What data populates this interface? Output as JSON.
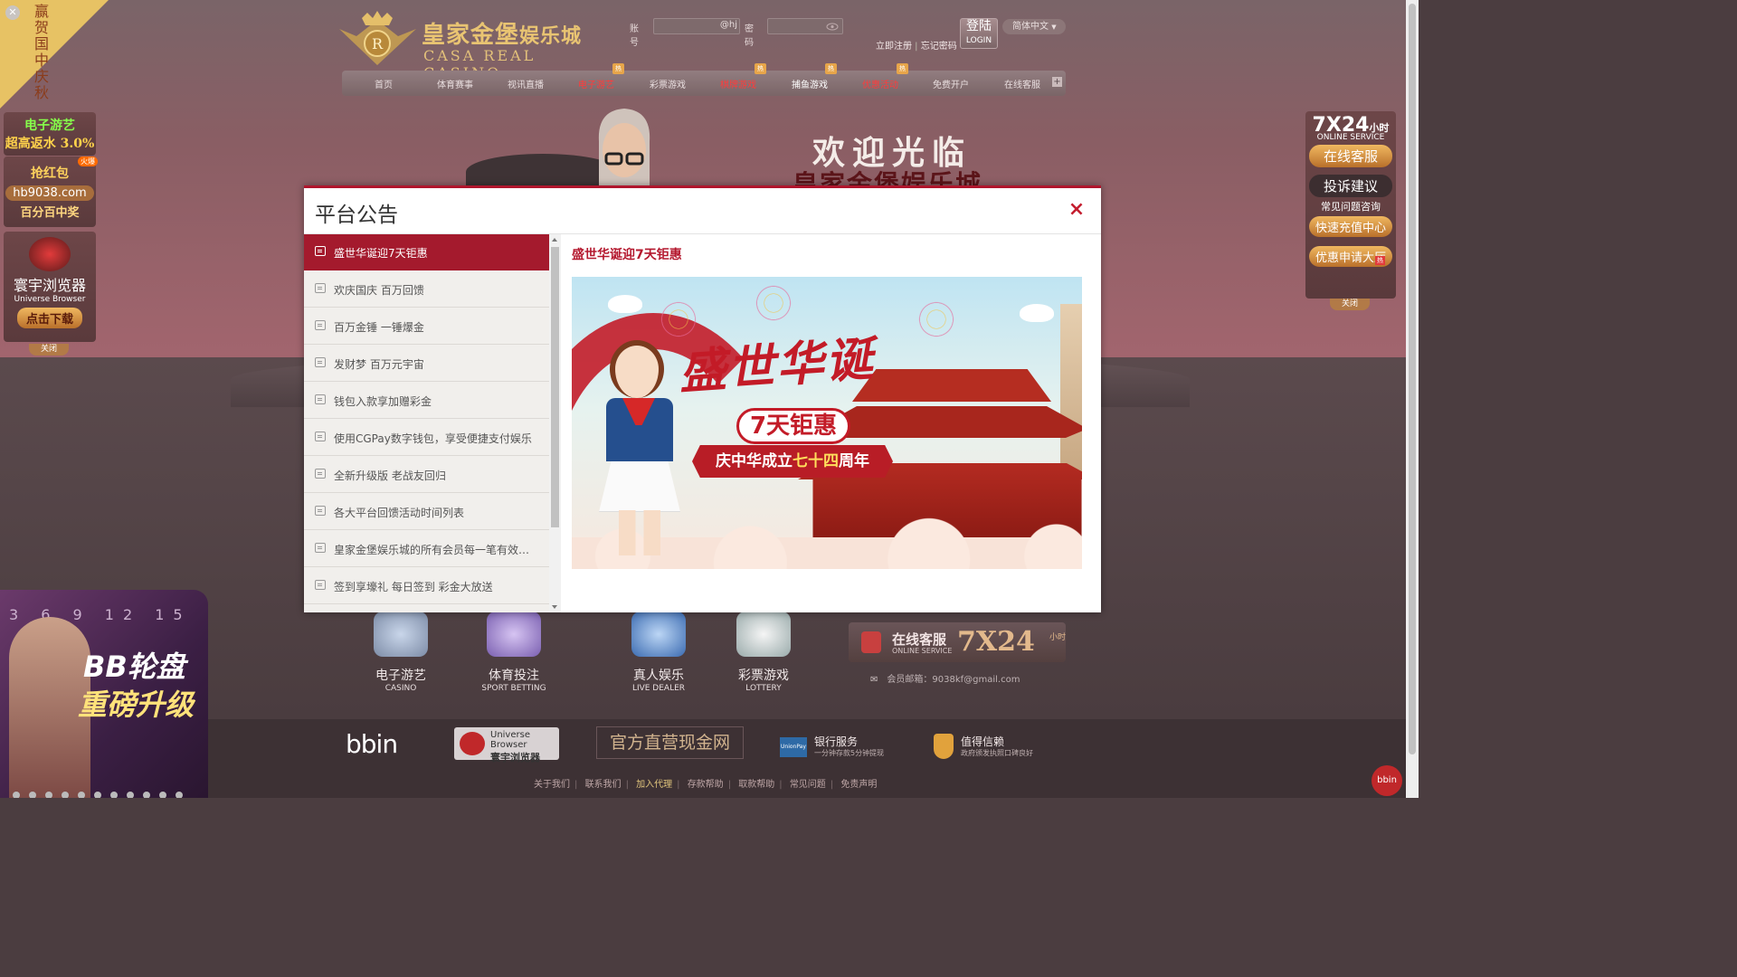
{
  "header": {
    "logo_cn_main": "皇家金堡",
    "logo_cn_small": "娱乐城",
    "logo_en": "CASA REAL CASINO",
    "account_label": "账号",
    "account_suffix": "@hj",
    "password_label": "密码",
    "login_label": "登陆",
    "login_sub": "LOGIN",
    "language": "简体中文",
    "register": "立即注册",
    "forgot": "忘记密码"
  },
  "nav": {
    "items": [
      {
        "label": "首页"
      },
      {
        "label": "体育赛事"
      },
      {
        "label": "视讯直播"
      },
      {
        "label": "电子游艺",
        "hot": "热"
      },
      {
        "label": "彩票游戏"
      },
      {
        "label": "棋牌游戏",
        "hot": "热"
      },
      {
        "label": "捕鱼游戏",
        "hot": "热"
      },
      {
        "label": "优惠活动",
        "hot": "热"
      },
      {
        "label": "免费开户"
      },
      {
        "label": "在线客服"
      }
    ],
    "plus": "+"
  },
  "hero": {
    "title": "欢迎光临",
    "subtitle": "皇家金堡娱乐城"
  },
  "left_ads": {
    "corner_text": "赢贺国中庆秋",
    "card1_title": "电子游艺",
    "card1_sub": "超高返水 3.0%",
    "card2_title": "抢红包",
    "card2_badge": "火爆",
    "card2_domain": "hb9038.com",
    "card2_sub": "百分百中奖",
    "card3_title": "寰宇浏览器",
    "card3_en": "Universe Browser",
    "card3_button": "点击下载",
    "close": "关闭"
  },
  "right_panel": {
    "big": "7X24",
    "big_unit": "小时",
    "en": "ONLINE SERVICE",
    "btn_online": "在线客服",
    "btn_complaint": "投诉建议",
    "faq": "常见问题咨询",
    "btn_recharge": "快速充值中心",
    "btn_promo": "优惠申请大厅",
    "hot": "热",
    "close": "关闭"
  },
  "games": [
    {
      "cn": "电子游艺",
      "en": "CASINO"
    },
    {
      "cn": "体育投注",
      "en": "SPORT BETTING"
    },
    {
      "cn": "真人娱乐",
      "en": "LIVE DEALER"
    },
    {
      "cn": "彩票游戏",
      "en": "LOTTERY"
    }
  ],
  "service": {
    "cn": "在线客服",
    "en": "ONLINE SERVICE",
    "big": "7X24",
    "unit": "小时",
    "email_label": "会员邮箱：",
    "email": "9038kf@gmail.com"
  },
  "footer": {
    "bbin": "bbin",
    "ub_en": "Universe Browser",
    "ub_cn": "寰宇浏览器",
    "official": "官方直营现金网",
    "bank_title": "银行服务",
    "bank_sub": "一分钟存款5分钟提现",
    "bank_icon": "UnionPay",
    "trust_title": "值得信赖",
    "trust_sub": "政府颁发执照口碑良好",
    "links": [
      "关于我们",
      "联系我们",
      "加入代理",
      "存款帮助",
      "取款帮助",
      "常见问题",
      "免责声明"
    ],
    "chat": "bbin"
  },
  "bb_ad": {
    "line1": "BB轮盘",
    "line2": "重磅升级",
    "numbers": "3 6 9 12 15"
  },
  "modal": {
    "title": "平台公告",
    "close": "×",
    "items": [
      "盛世华诞迎7天钜惠",
      "欢庆国庆 百万回馈",
      "百万金锤 一锤爆金",
      "发财梦 百万元宇宙",
      "钱包入款享加赠彩金",
      "使用CGPay数字钱包，享受便捷支付娱乐",
      "全新升级版 老战友回归",
      "各大平台回馈活动时间列表",
      "皇家金堡娱乐城的所有会员每一笔有效投注都可获得返水",
      "签到享壕礼 每日签到 彩金大放送"
    ],
    "active_index": 0,
    "content_title": "盛世华诞迎7天钜惠",
    "banner": {
      "headline": "盛世华诞",
      "pill": "7天钜惠",
      "ribbon_a": "庆中华成立",
      "ribbon_b": "七十四",
      "ribbon_c": "周年"
    }
  }
}
